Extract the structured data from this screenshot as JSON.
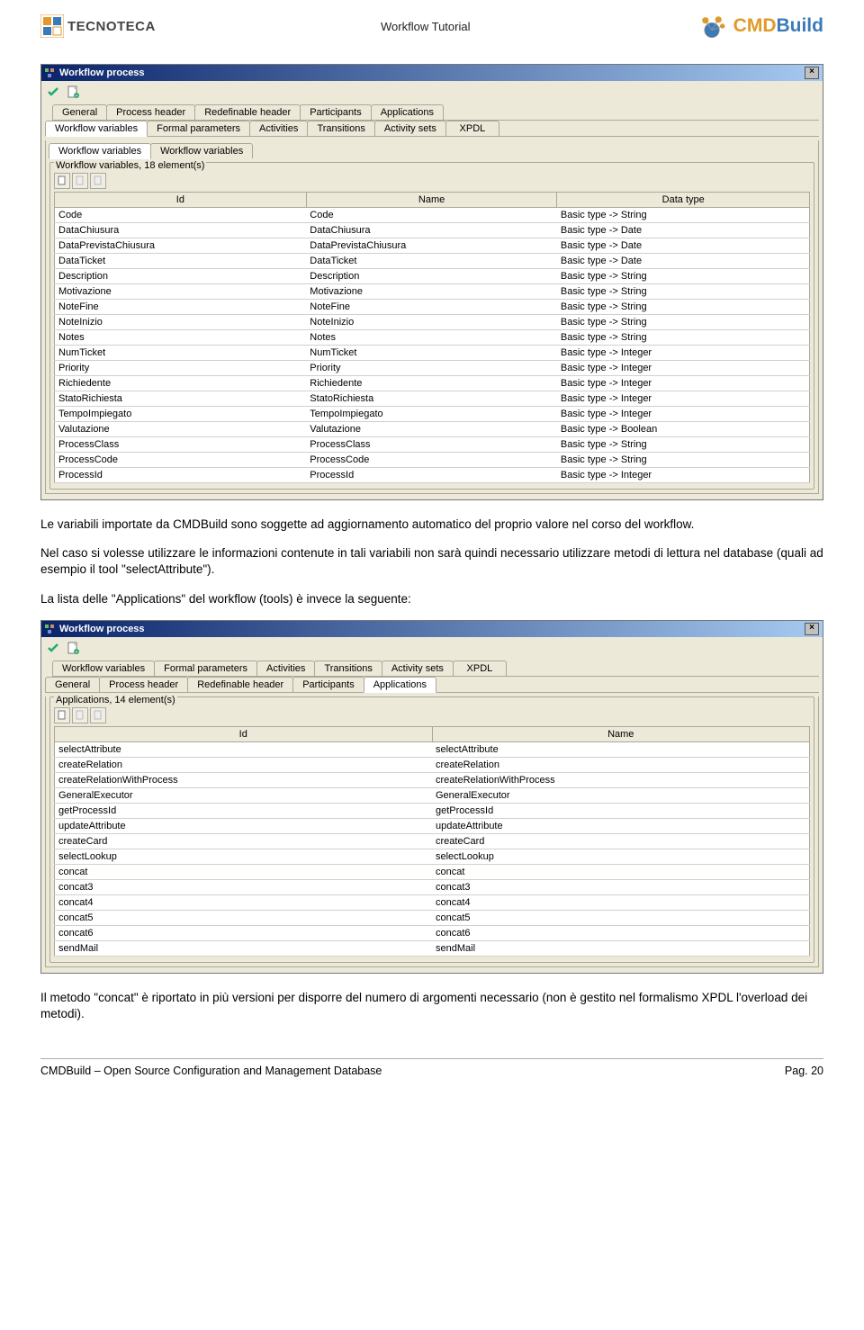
{
  "header": {
    "left_logo_text": "TECNOTECA",
    "title": "Workflow Tutorial",
    "right_logo_cmd": "CMD",
    "right_logo_build": "Build"
  },
  "window1": {
    "title": "Workflow process",
    "tabs_row1": [
      "General",
      "Process header",
      "Redefinable header",
      "Participants",
      "Applications"
    ],
    "tabs_row2": [
      "Workflow variables",
      "Formal parameters",
      "Activities",
      "Transitions",
      "Activity sets",
      "XPDL"
    ],
    "active_tab": "Workflow variables",
    "subtabs": [
      "Workflow variables",
      "Workflow variables"
    ],
    "fieldset_label": "Workflow variables, 18 element(s)",
    "columns": [
      "Id",
      "Name",
      "Data type"
    ],
    "rows": [
      [
        "Code",
        "Code",
        "Basic type -> String"
      ],
      [
        "DataChiusura",
        "DataChiusura",
        "Basic type -> Date"
      ],
      [
        "DataPrevistaChiusura",
        "DataPrevistaChiusura",
        "Basic type -> Date"
      ],
      [
        "DataTicket",
        "DataTicket",
        "Basic type -> Date"
      ],
      [
        "Description",
        "Description",
        "Basic type -> String"
      ],
      [
        "Motivazione",
        "Motivazione",
        "Basic type -> String"
      ],
      [
        "NoteFine",
        "NoteFine",
        "Basic type -> String"
      ],
      [
        "NoteInizio",
        "NoteInizio",
        "Basic type -> String"
      ],
      [
        "Notes",
        "Notes",
        "Basic type -> String"
      ],
      [
        "NumTicket",
        "NumTicket",
        "Basic type -> Integer"
      ],
      [
        "Priority",
        "Priority",
        "Basic type -> Integer"
      ],
      [
        "Richiedente",
        "Richiedente",
        "Basic type -> Integer"
      ],
      [
        "StatoRichiesta",
        "StatoRichiesta",
        "Basic type -> Integer"
      ],
      [
        "TempoImpiegato",
        "TempoImpiegato",
        "Basic type -> Integer"
      ],
      [
        "Valutazione",
        "Valutazione",
        "Basic type -> Boolean"
      ],
      [
        "ProcessClass",
        "ProcessClass",
        "Basic type -> String"
      ],
      [
        "ProcessCode",
        "ProcessCode",
        "Basic type -> String"
      ],
      [
        "ProcessId",
        "ProcessId",
        "Basic type -> Integer"
      ]
    ]
  },
  "para1": "Le variabili importate da CMDBuild sono soggette ad aggiornamento automatico del proprio valore nel corso del workflow.",
  "para2": "Nel caso si volesse utilizzare le informazioni contenute in tali variabili non sarà quindi necessario utilizzare metodi di lettura nel database (quali ad esempio il tool \"selectAttribute\").",
  "para3": "La lista delle \"Applications\" del workflow (tools) è invece la seguente:",
  "window2": {
    "title": "Workflow process",
    "tabs_row1": [
      "Workflow variables",
      "Formal parameters",
      "Activities",
      "Transitions",
      "Activity sets",
      "XPDL"
    ],
    "tabs_row2": [
      "General",
      "Process header",
      "Redefinable header",
      "Participants",
      "Applications"
    ],
    "active_tab": "Applications",
    "fieldset_label": "Applications, 14 element(s)",
    "columns": [
      "Id",
      "Name"
    ],
    "rows": [
      [
        "selectAttribute",
        "selectAttribute"
      ],
      [
        "createRelation",
        "createRelation"
      ],
      [
        "createRelationWithProcess",
        "createRelationWithProcess"
      ],
      [
        "GeneralExecutor",
        "GeneralExecutor"
      ],
      [
        "getProcessId",
        "getProcessId"
      ],
      [
        "updateAttribute",
        "updateAttribute"
      ],
      [
        "createCard",
        "createCard"
      ],
      [
        "selectLookup",
        "selectLookup"
      ],
      [
        "concat",
        "concat"
      ],
      [
        "concat3",
        "concat3"
      ],
      [
        "concat4",
        "concat4"
      ],
      [
        "concat5",
        "concat5"
      ],
      [
        "concat6",
        "concat6"
      ],
      [
        "sendMail",
        "sendMail"
      ]
    ]
  },
  "para4": "Il metodo \"concat\" è riportato in più versioni per disporre del numero di argomenti necessario (non è gestito nel formalismo XPDL l'overload dei metodi).",
  "footer": {
    "left": "CMDBuild – Open Source Configuration and Management Database",
    "right": "Pag. 20"
  }
}
